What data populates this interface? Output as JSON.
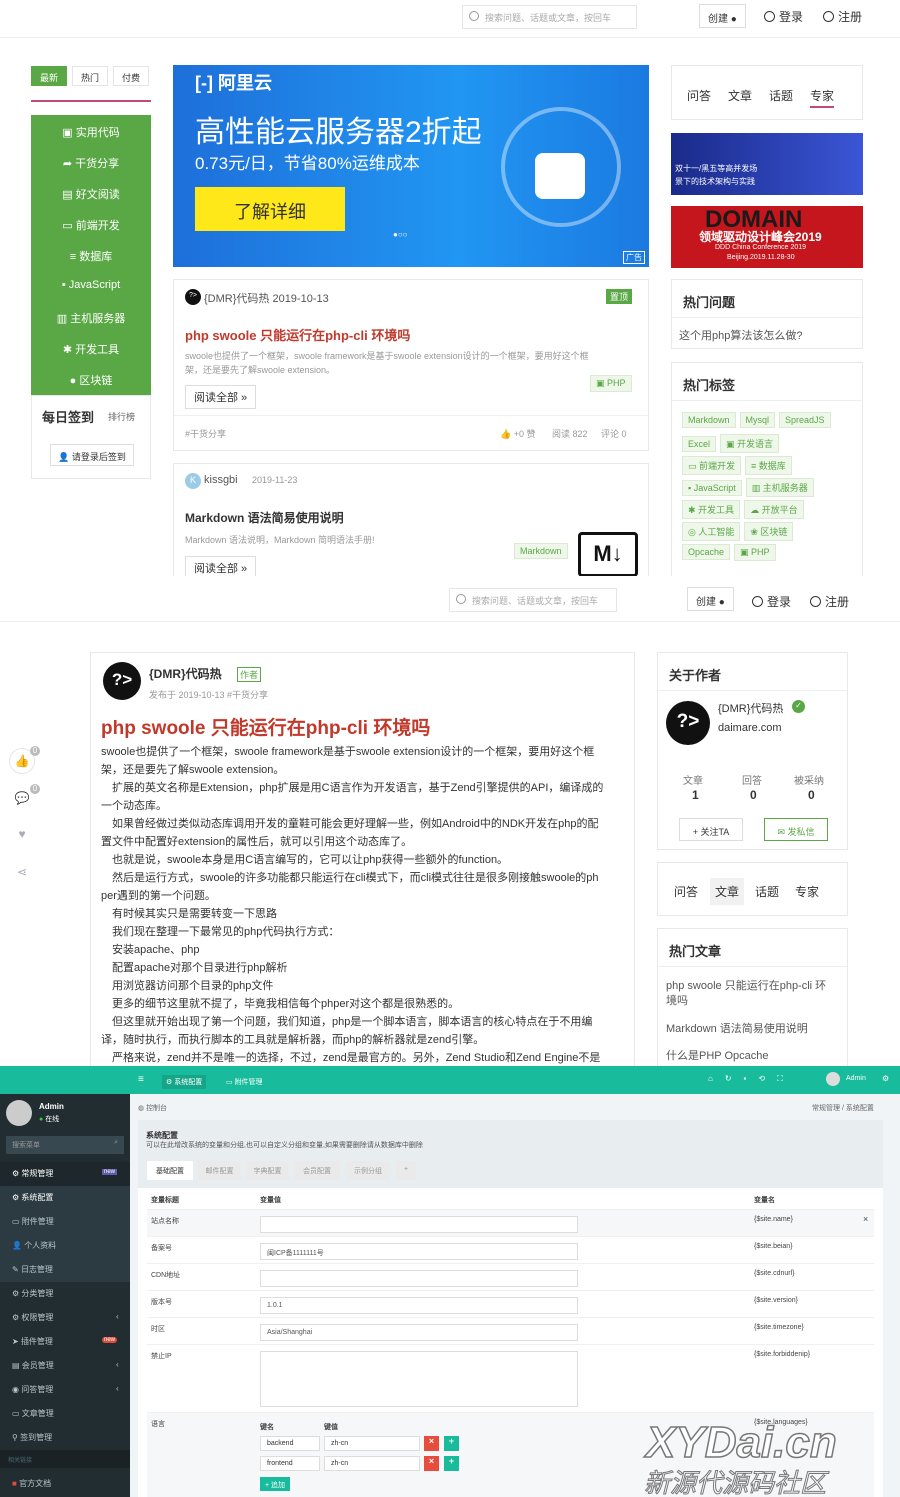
{
  "screen1": {
    "search_placeholder": "搜索问题、话题或文章，按回车",
    "create_label": "创建",
    "login_label": "登录",
    "register_label": "注册",
    "sort_tabs": [
      "最新",
      "热门",
      "付费"
    ],
    "categories": [
      "实用代码",
      "干货分享",
      "好文阅读",
      "前端开发",
      "数据库",
      "JavaScript",
      "主机服务器",
      "开发工具",
      "区块链"
    ],
    "checkin_title": "每日签到",
    "checkin_rank": "排行榜",
    "checkin_button": "请登录后签到",
    "banner": {
      "logo": "阿里云",
      "headline": "高性能云服务器2折起",
      "subline": "0.73元/日，节省80%运维成本",
      "cta": "了解详细",
      "ad": "广告"
    },
    "side_tabs": [
      "问答",
      "文章",
      "话题",
      "专家"
    ],
    "ad1_lines": [
      "双十一/黑五等高并发场",
      "景下的技术架构与实践"
    ],
    "ad2": {
      "title": "DOMAIN",
      "line1": "领域驱动设计峰会2019",
      "line2": "DDD China Conference 2019",
      "line3": "Beijing.2019.11.28-30"
    },
    "hot_questions_title": "热门问题",
    "hot_question": "这个用php算法该怎么做?",
    "hot_tags_title": "热门标签",
    "hot_tags": [
      [
        "Markdown",
        "Mysql",
        "SpreadJS"
      ],
      [
        "Excel",
        "开发语言"
      ],
      [
        "前端开发",
        "数据库"
      ],
      [
        "JavaScript",
        "主机服务器"
      ],
      [
        "开发工具",
        "开放平台"
      ],
      [
        "人工智能",
        "区块链"
      ],
      [
        "Opcache",
        "PHP"
      ]
    ],
    "post1": {
      "author": "{DMR}代码热 2019-10-13",
      "pinned": "置顶",
      "title": "php swoole 只能运行在php-cli 环境吗",
      "excerpt1": "swoole也提供了一个框架，swoole framework是基于swoole extension设计的一个框架，要用好这个框",
      "excerpt2": "架，还是要先了解swoole extension。",
      "tag": "PHP",
      "read_all": "阅读全部 »",
      "category": "#干货分享",
      "likes": "+0 赞",
      "views": "阅读 822",
      "comments": "评论 0"
    },
    "post2": {
      "author": "kissgbi",
      "date": "2019-11-23",
      "title": "Markdown 语法简易使用说明",
      "excerpt": "Markdown 语法说明，Markdown 简明语法手册!",
      "tag": "Markdown",
      "read_all": "阅读全部 »",
      "logo": "M↓"
    }
  },
  "screen2": {
    "search_placeholder": "搜索问题、话题或文章，按回车",
    "create_label": "创建",
    "login_label": "登录",
    "register_label": "注册",
    "side_counts": [
      "0",
      "0"
    ],
    "author": "{DMR}代码热",
    "author_badge": "作者",
    "meta": "发布于 2019-10-13 #干货分享",
    "title": "php swoole 只能运行在php-cli 环境吗",
    "paragraphs": [
      "swoole也提供了一个框架，swoole framework是基于swoole extension设计的一个框架，要用好这个框",
      "架，还是要先了解swoole extension。",
      "　扩展的英文名称是Extension，php扩展是用C语言作为开发语言，基于Zend引擎提供的API，编译成的",
      "一个动态库。",
      "　如果曾经做过类似动态库调用开发的童鞋可能会更好理解一些，例如Android中的NDK开发在php的配",
      "置文件中配置好extension的属性后，就可以引用这个动态库了。",
      "　也就是说，swoole本身是用C语言编写的，它可以让php获得一些额外的function。",
      "　然后是运行方式，swoole的许多功能都只能运行在cli模式下，而cli模式往往是很多刚接触swoole的ph",
      "per遇到的第一个问题。",
      "　有时候其实只是需要转变一下思路",
      "　我们现在整理一下最常见的php代码执行方式：",
      "　安装apache、php",
      "　配置apache对那个目录进行php解析",
      "　用浏览器访问那个目录的php文件",
      "　更多的细节这里就不提了，毕竟我相信每个phper对这个都是很熟悉的。",
      "　但这里就开始出现了第一个问题，我们知道，php是一个脚本语言，脚本语言的核心特点在于不用编",
      "译，随时执行，而执行脚本的工具就是解析器，而php的解析器就是zend引擎。",
      "　严格来说，zend并不是唯一的选择，不过，zend是最官方的。另外，Zend Studio和Zend Engine不是"
    ],
    "about_title": "关于作者",
    "about_name": "{DMR}代码热",
    "about_site": "daimare.com",
    "stat_labels": [
      "文章",
      "回答",
      "被采纳"
    ],
    "stat_values": [
      "1",
      "0",
      "0"
    ],
    "follow_label": "+ 关注TA",
    "message_label": "发私信",
    "side_tabs": [
      "问答",
      "文章",
      "话题",
      "专家"
    ],
    "hot_articles_title": "热门文章",
    "hot_articles": [
      "php swoole 只能运行在php-cli 环",
      "境吗",
      "Markdown 语法简易使用说明",
      "什么是PHP Opcache"
    ]
  },
  "screen3": {
    "top_tabs": [
      "系统配置",
      "附件管理"
    ],
    "user": "Admin",
    "status": "在线",
    "search_placeholder": "搜索菜单",
    "breadcrumb_left": "控制台",
    "breadcrumb_right": [
      "常规管理",
      "系统配置"
    ],
    "menu": [
      {
        "label": "常规管理",
        "badge": "new"
      },
      {
        "label": "系统配置"
      },
      {
        "label": "附件管理"
      },
      {
        "label": "个人资料"
      },
      {
        "label": "日志管理"
      },
      {
        "label": "分类管理"
      },
      {
        "label": "权限管理"
      },
      {
        "label": "插件管理",
        "badge": "new"
      },
      {
        "label": "会员管理"
      },
      {
        "label": "问答管理"
      },
      {
        "label": "文章管理"
      },
      {
        "label": "签到管理"
      }
    ],
    "menu_section": "相关链接",
    "menu_doc": "官方文档",
    "panel_title": "系统配置",
    "panel_desc": "可以在此增改系统的变量和分组,也可以自定义分组和变量,如果需要删除请从数据库中删除",
    "config_tabs": [
      "基础配置",
      "邮件配置",
      "字典配置",
      "会员配置",
      "示例分组",
      "+"
    ],
    "col_headers": [
      "变量标题",
      "变量值",
      "变量名"
    ],
    "rows": [
      {
        "label": "站点名称",
        "value": "",
        "var": "{$site.name}"
      },
      {
        "label": "备案号",
        "value": "闽ICP备1111111号",
        "var": "{$site.beian}"
      },
      {
        "label": "CDN地址",
        "value": "",
        "var": "{$site.cdnurl}"
      },
      {
        "label": "版本号",
        "value": "1.0.1",
        "var": "{$site.version}"
      },
      {
        "label": "时区",
        "value": "Asia/Shanghai",
        "var": "{$site.timezone}"
      },
      {
        "label": "禁止IP",
        "value": "",
        "var": "{$site.forbiddenip}"
      },
      {
        "label": "语言",
        "value": "",
        "var": "{$site.languages}"
      }
    ],
    "lang_headers": [
      "键名",
      "键值"
    ],
    "lang_rows": [
      [
        "backend",
        "zh-cn"
      ],
      [
        "frontend",
        "zh-cn"
      ]
    ],
    "append_label": "+ 追加",
    "close_x": "×"
  },
  "watermark": {
    "line1": "XYDai.cn",
    "line2": "新源代源码社区"
  },
  "colors": {
    "green": "#5aa845",
    "red": "#d9534f",
    "teal": "#18bc9c",
    "adminSide": "#222d32",
    "link": "#c0392b",
    "blue": "#1e6fd9"
  }
}
